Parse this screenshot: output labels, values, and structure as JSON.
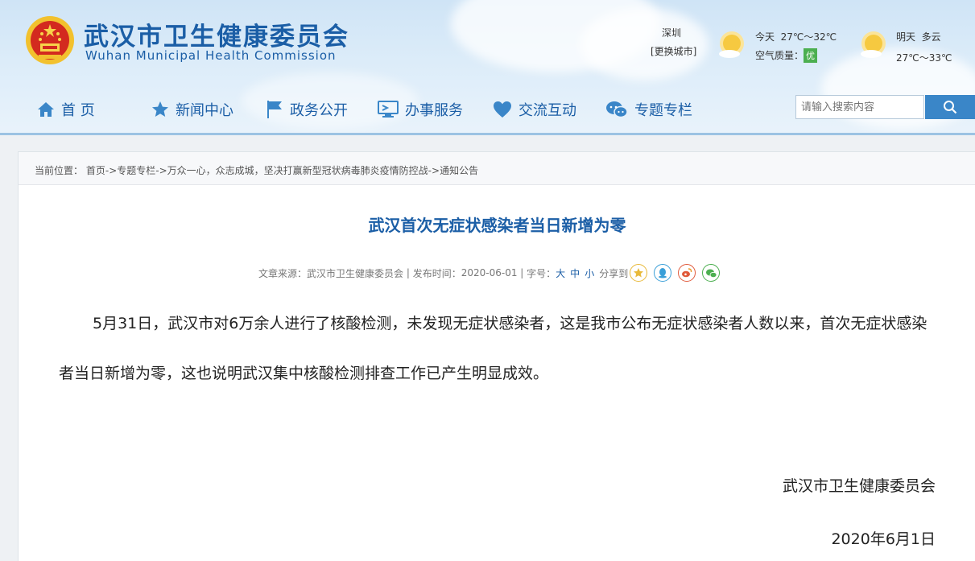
{
  "header": {
    "title": "武汉市卫生健康委员会",
    "subtitle": "Wuhan Municipal Health Commission",
    "logo_icon": "national-emblem-icon"
  },
  "weather": {
    "city": "深圳",
    "change_city": "[更换城市]",
    "today_label": "今天",
    "today_temp": "27℃～32℃",
    "air_quality_label": "空气质量：",
    "air_quality_value": "优",
    "tomorrow_label": "明天",
    "tomorrow_condition": "多云",
    "tomorrow_temp": "27℃～33℃",
    "icon": "sunny-icon"
  },
  "nav": {
    "items": [
      {
        "label": "首 页",
        "icon": "home-icon"
      },
      {
        "label": "新闻中心",
        "icon": "star-icon"
      },
      {
        "label": "政务公开",
        "icon": "flag-icon"
      },
      {
        "label": "办事服务",
        "icon": "monitor-icon"
      },
      {
        "label": "交流互动",
        "icon": "heart-icon"
      },
      {
        "label": "专题专栏",
        "icon": "chat-icon"
      }
    ]
  },
  "search": {
    "placeholder": "请输入搜索内容"
  },
  "breadcrumb": {
    "prefix": "当前位置：",
    "items": [
      "首页",
      "专题专栏",
      "万众一心，众志成城，坚决打赢新型冠状病毒肺炎疫情防控战",
      "通知公告"
    ],
    "separator": "->"
  },
  "article": {
    "title": "武汉首次无症状感染者当日新增为零",
    "source_label": "文章来源：",
    "source": "武汉市卫生健康委员会",
    "date_label": "发布时间：",
    "date": "2020-06-01",
    "fontsize_label": "字号：",
    "fontsize_options": [
      "大",
      "中",
      "小"
    ],
    "share_label": "分享到",
    "share_icons": [
      "qzone-icon",
      "qq-icon",
      "weibo-icon",
      "wechat-icon"
    ],
    "body": "5月31日，武汉市对6万余人进行了核酸检测，未发现无症状感染者，这是我市公布无症状感染者人数以来，首次无症状感染者当日新增为零，这也说明武汉集中核酸检测排查工作已产生明显成效。",
    "signature": "武汉市卫生健康委员会",
    "sign_date": "2020年6月1日"
  },
  "colors": {
    "brand_blue": "#1b5ea6",
    "search_button": "#3a86c8",
    "air_quality_good": "#4caf50"
  }
}
